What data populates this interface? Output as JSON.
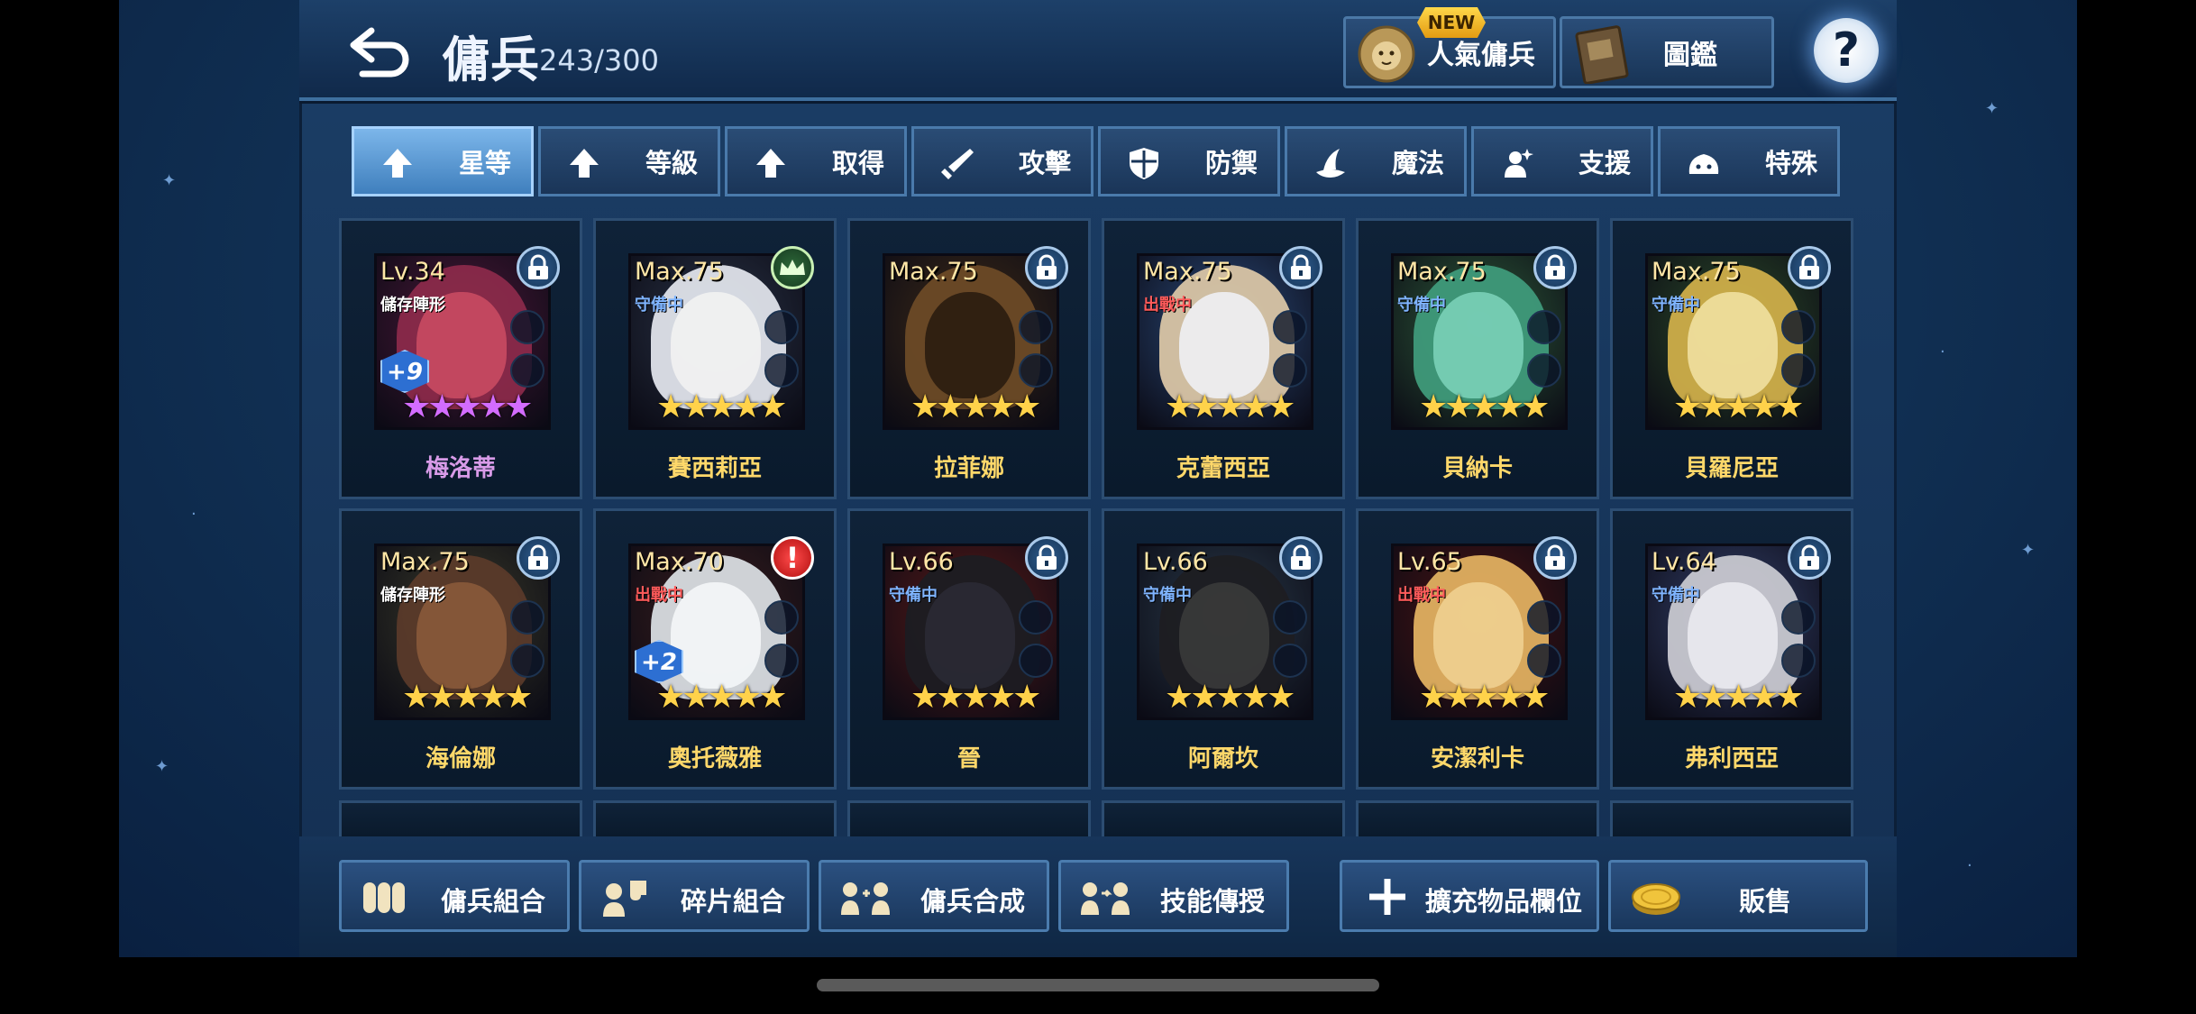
{
  "header": {
    "title": "傭兵",
    "count": "243/300",
    "popular_label": "人氣傭兵",
    "codex_label": "圖鑑",
    "new_badge": "NEW",
    "help_label": "?"
  },
  "tabs": [
    {
      "label": "星等",
      "icon": "arrow-up-icon",
      "active": true
    },
    {
      "label": "等級",
      "icon": "arrow-up-icon",
      "active": false
    },
    {
      "label": "取得",
      "icon": "arrow-up-icon",
      "active": false
    },
    {
      "label": "攻擊",
      "icon": "sword-icon",
      "active": false
    },
    {
      "label": "防禦",
      "icon": "shield-icon",
      "active": false
    },
    {
      "label": "魔法",
      "icon": "wizard-hat-icon",
      "active": false
    },
    {
      "label": "支援",
      "icon": "support-icon",
      "active": false
    },
    {
      "label": "特殊",
      "icon": "blob-icon",
      "active": false
    }
  ],
  "mercenaries": [
    {
      "name": "梅洛蒂",
      "level": "Lv.34",
      "status": "儲存陣形",
      "badge": "lock",
      "plus": "+9",
      "stars": "★★★★★",
      "star_color": "purple",
      "name_color": "#d89be8"
    },
    {
      "name": "賽西莉亞",
      "level": "Max.75",
      "status": "守備中",
      "badge": "crown",
      "plus": "",
      "stars": "★★★★★",
      "star_color": "gold",
      "name_color": "#ffd86a"
    },
    {
      "name": "拉菲娜",
      "level": "Max.75",
      "status": "",
      "badge": "lock",
      "plus": "",
      "stars": "★★★★★",
      "star_color": "gold",
      "name_color": "#ffd86a"
    },
    {
      "name": "克蕾西亞",
      "level": "Max.75",
      "status": "出戰中",
      "badge": "lock",
      "plus": "",
      "stars": "★★★★★",
      "star_color": "gold",
      "name_color": "#ffd86a"
    },
    {
      "name": "貝納卡",
      "level": "Max.75",
      "status": "守備中",
      "badge": "lock",
      "plus": "",
      "stars": "★★★★★",
      "star_color": "gold",
      "name_color": "#ffd86a"
    },
    {
      "name": "貝羅尼亞",
      "level": "Max.75",
      "status": "守備中",
      "badge": "lock",
      "plus": "",
      "stars": "★★★★★",
      "star_color": "gold",
      "name_color": "#ffd86a"
    },
    {
      "name": "海倫娜",
      "level": "Max.75",
      "status": "儲存陣形",
      "badge": "lock",
      "plus": "",
      "stars": "★★★★★",
      "star_color": "gold",
      "name_color": "#ffd86a"
    },
    {
      "name": "奧托薇雅",
      "level": "Max.70",
      "status": "出戰中",
      "badge": "alert",
      "plus": "+2",
      "stars": "★★★★★",
      "star_color": "gold",
      "name_color": "#ffd86a"
    },
    {
      "name": "晉",
      "level": "Lv.66",
      "status": "守備中",
      "badge": "lock",
      "plus": "",
      "stars": "★★★★★",
      "star_color": "gold",
      "name_color": "#ffd86a"
    },
    {
      "name": "阿爾坎",
      "level": "Lv.66",
      "status": "守備中",
      "badge": "lock",
      "plus": "",
      "stars": "★★★★★",
      "star_color": "gold",
      "name_color": "#ffd86a"
    },
    {
      "name": "安潔利卡",
      "level": "Lv.65",
      "status": "出戰中",
      "badge": "lock",
      "plus": "",
      "stars": "★★★★★",
      "star_color": "gold",
      "name_color": "#ffd86a"
    },
    {
      "name": "弗利西亞",
      "level": "Lv.64",
      "status": "守備中",
      "badge": "lock",
      "plus": "",
      "stars": "★★★★★",
      "star_color": "gold",
      "name_color": "#ffd86a"
    }
  ],
  "bottom_actions": [
    {
      "label": "傭兵組合",
      "icon": "mercenary-group-icon"
    },
    {
      "label": "碎片組合",
      "icon": "puzzle-piece-icon"
    },
    {
      "label": "傭兵合成",
      "icon": "fusion-icon"
    },
    {
      "label": "技能傳授",
      "icon": "skill-transfer-icon"
    },
    {
      "label": "擴充物品欄位",
      "icon": "plus-icon"
    },
    {
      "label": "販售",
      "icon": "gold-coin-icon"
    }
  ],
  "colors": {
    "status_defending": "#7fb4ff",
    "status_battle": "#ff5b5b",
    "status_saved": "#ffffff",
    "accent_gold": "#ffd24a"
  }
}
